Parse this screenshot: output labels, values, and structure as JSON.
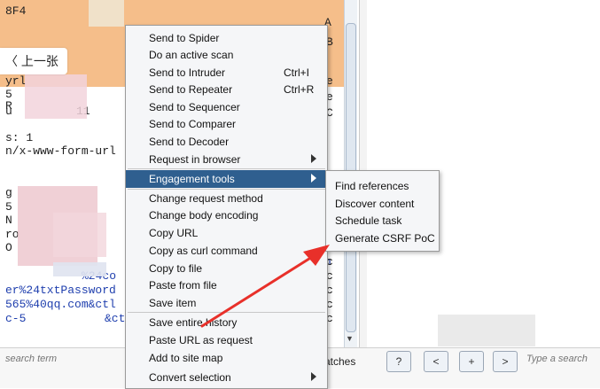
{
  "editor": {
    "lines": [
      {
        "text": "8F4",
        "cls": ""
      },
      {
        "text": "A",
        "cls": ""
      },
      {
        "text": "yrl",
        "cls": ""
      },
      {
        "text": "5",
        "cls": ""
      },
      {
        "text": "R",
        "cls": ""
      },
      {
        "text": "u",
        "cls": ""
      },
      {
        "text": "11",
        "cls": ""
      },
      {
        "text": "s: 1",
        "cls": ""
      },
      {
        "text": "n/x-www-form-url",
        "cls": ""
      },
      {
        "text": "g",
        "cls": ""
      },
      {
        "text": "5",
        "cls": ""
      },
      {
        "text": "N",
        "cls": ""
      },
      {
        "text": "ro",
        "cls": ""
      },
      {
        "text": "O",
        "cls": ""
      },
      {
        "text": "n",
        "cls": "blue"
      },
      {
        "text": "%24co",
        "cls": "blue"
      },
      {
        "text": "er%24txtPassword",
        "cls": "blue"
      },
      {
        "text": "565%40qq.com&ctl",
        "cls": "blue"
      },
      {
        "text": "c-5",
        "cls": "blue"
      },
      {
        "text": "&ct",
        "cls": "blue"
      }
    ],
    "right_edge_chars": [
      "B",
      "",
      "e",
      "e",
      "C",
      "e",
      "h",
      "h",
      "c",
      "c",
      "c",
      "c",
      "c"
    ]
  },
  "back_button": {
    "label": "〈 上一张"
  },
  "context_menu": {
    "items": [
      {
        "label": "Send to Spider",
        "shortcut": "",
        "has_submenu": false,
        "active": false
      },
      {
        "label": "Do an active scan",
        "shortcut": "",
        "has_submenu": false,
        "active": false
      },
      {
        "label": "Send to Intruder",
        "shortcut": "Ctrl+I",
        "has_submenu": false,
        "active": false
      },
      {
        "label": "Send to Repeater",
        "shortcut": "Ctrl+R",
        "has_submenu": false,
        "active": false
      },
      {
        "label": "Send to Sequencer",
        "shortcut": "",
        "has_submenu": false,
        "active": false
      },
      {
        "label": "Send to Comparer",
        "shortcut": "",
        "has_submenu": false,
        "active": false
      },
      {
        "label": "Send to Decoder",
        "shortcut": "",
        "has_submenu": false,
        "active": false
      },
      {
        "label": "Request in browser",
        "shortcut": "",
        "has_submenu": true,
        "active": false
      },
      {
        "label": "Engagement tools",
        "shortcut": "",
        "has_submenu": true,
        "active": true
      },
      {
        "label": "Change request method",
        "shortcut": "",
        "has_submenu": false,
        "active": false
      },
      {
        "label": "Change body encoding",
        "shortcut": "",
        "has_submenu": false,
        "active": false
      },
      {
        "label": "Copy URL",
        "shortcut": "",
        "has_submenu": false,
        "active": false
      },
      {
        "label": "Copy as curl command",
        "shortcut": "",
        "has_submenu": false,
        "active": false
      },
      {
        "label": "Copy to file",
        "shortcut": "",
        "has_submenu": false,
        "active": false
      },
      {
        "label": "Paste from file",
        "shortcut": "",
        "has_submenu": false,
        "active": false
      },
      {
        "label": "Save item",
        "shortcut": "",
        "has_submenu": false,
        "active": false
      },
      {
        "label": "Save entire history",
        "shortcut": "",
        "has_submenu": false,
        "active": false
      },
      {
        "label": "Paste URL as request",
        "shortcut": "",
        "has_submenu": false,
        "active": false
      },
      {
        "label": "Add to site map",
        "shortcut": "",
        "has_submenu": false,
        "active": false
      },
      {
        "label": "Convert selection",
        "shortcut": "",
        "has_submenu": true,
        "active": false
      }
    ]
  },
  "engagement_submenu": {
    "items": [
      {
        "label": "Find references"
      },
      {
        "label": "Discover content"
      },
      {
        "label": "Schedule task"
      },
      {
        "label": "Generate CSRF PoC"
      }
    ]
  },
  "bottom_bar": {
    "search_placeholder": "search term",
    "matches_label": "atches",
    "buttons": [
      "?",
      "<",
      "+",
      ">"
    ],
    "search_placeholder_right": "Type a search"
  },
  "colors": {
    "menu_highlight": "#2f5f8f",
    "selection_band": "#f5be8a",
    "annotation_arrow": "#e8302a"
  }
}
